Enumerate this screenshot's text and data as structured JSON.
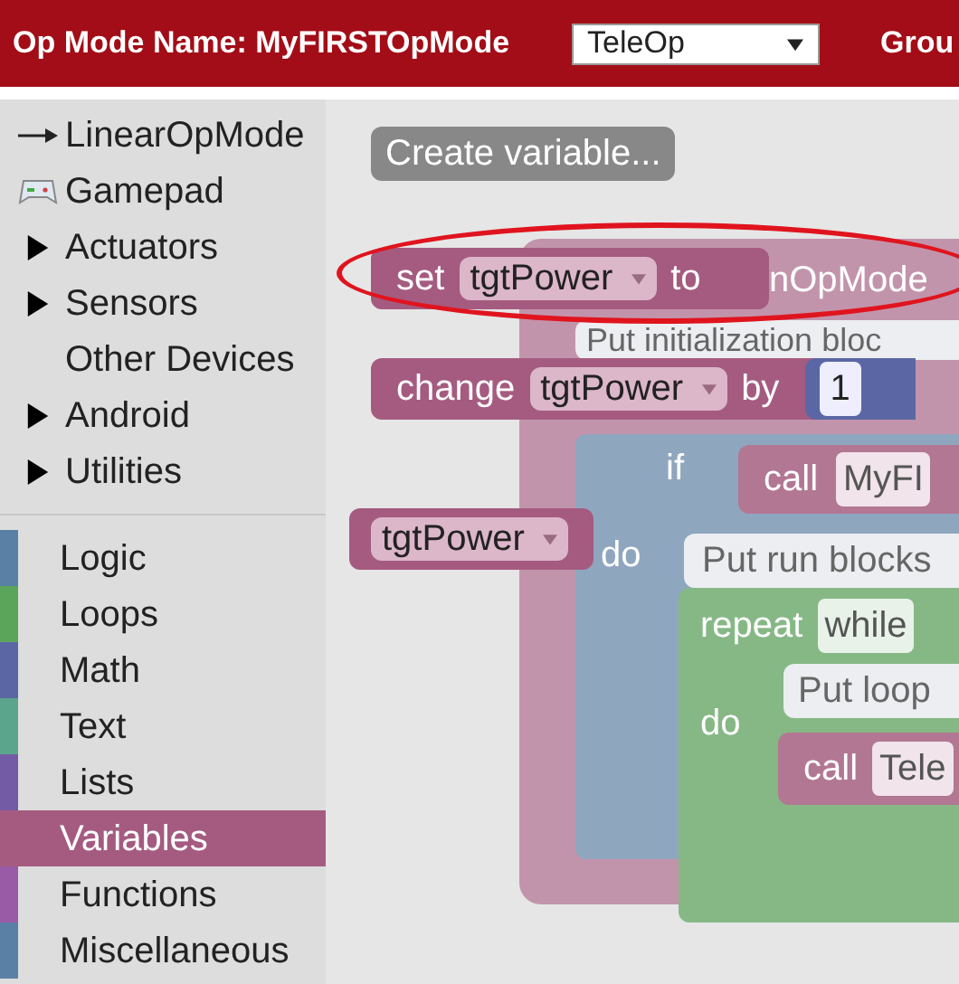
{
  "header": {
    "title": "Op Mode Name: MyFIRSTOpMode",
    "type_select": "TeleOp",
    "group_label": "Grou"
  },
  "toolbox": {
    "items": [
      {
        "label": "LinearOpMode",
        "kind": "arrow"
      },
      {
        "label": "Gamepad",
        "kind": "gamepad"
      },
      {
        "label": "Actuators",
        "kind": "folder",
        "expanded": false
      },
      {
        "label": "Sensors",
        "kind": "folder",
        "expanded": false
      },
      {
        "label": "Other Devices",
        "kind": "plain"
      },
      {
        "label": "Android",
        "kind": "folder",
        "expanded": false
      },
      {
        "label": "Utilities",
        "kind": "folder",
        "expanded": false
      }
    ],
    "categories": [
      {
        "label": "Logic",
        "color": "#5b80a5",
        "selected": false
      },
      {
        "label": "Loops",
        "color": "#5ba55b",
        "selected": false
      },
      {
        "label": "Math",
        "color": "#5b67a5",
        "selected": false
      },
      {
        "label": "Text",
        "color": "#5ba58c",
        "selected": false
      },
      {
        "label": "Lists",
        "color": "#745ba5",
        "selected": false
      },
      {
        "label": "Variables",
        "color": "#a55b80",
        "selected": true
      },
      {
        "label": "Functions",
        "color": "#995ba5",
        "selected": false
      },
      {
        "label": "Miscellaneous",
        "color": "#5b80a5",
        "selected": false
      }
    ]
  },
  "flyout": {
    "button": "Create variable...",
    "blocks": [
      {
        "kind": "set",
        "keyword": "set",
        "variable": "tgtPower",
        "suffix": "to",
        "highlighted": true
      },
      {
        "kind": "change",
        "keyword": "change",
        "variable": "tgtPower",
        "suffix": "by",
        "value": "1",
        "highlighted": false
      },
      {
        "kind": "get",
        "variable": "tgtPower",
        "highlighted": false
      }
    ]
  },
  "workspace_blocks": [
    {
      "kind": "procedure",
      "texts": [
        "nOpMode"
      ]
    },
    {
      "kind": "comment",
      "texts": [
        "Put initialization bloc"
      ]
    },
    {
      "kind": "if",
      "texts": [
        "if",
        "do"
      ]
    },
    {
      "kind": "call",
      "texts": [
        "call",
        "MyFI"
      ]
    },
    {
      "kind": "comment",
      "texts": [
        "Put run blocks"
      ]
    },
    {
      "kind": "loop",
      "texts": [
        "repeat",
        "while",
        "do"
      ]
    },
    {
      "kind": "comment",
      "texts": [
        "Put loop"
      ]
    },
    {
      "kind": "call",
      "texts": [
        "call",
        "Tele"
      ]
    }
  ]
}
